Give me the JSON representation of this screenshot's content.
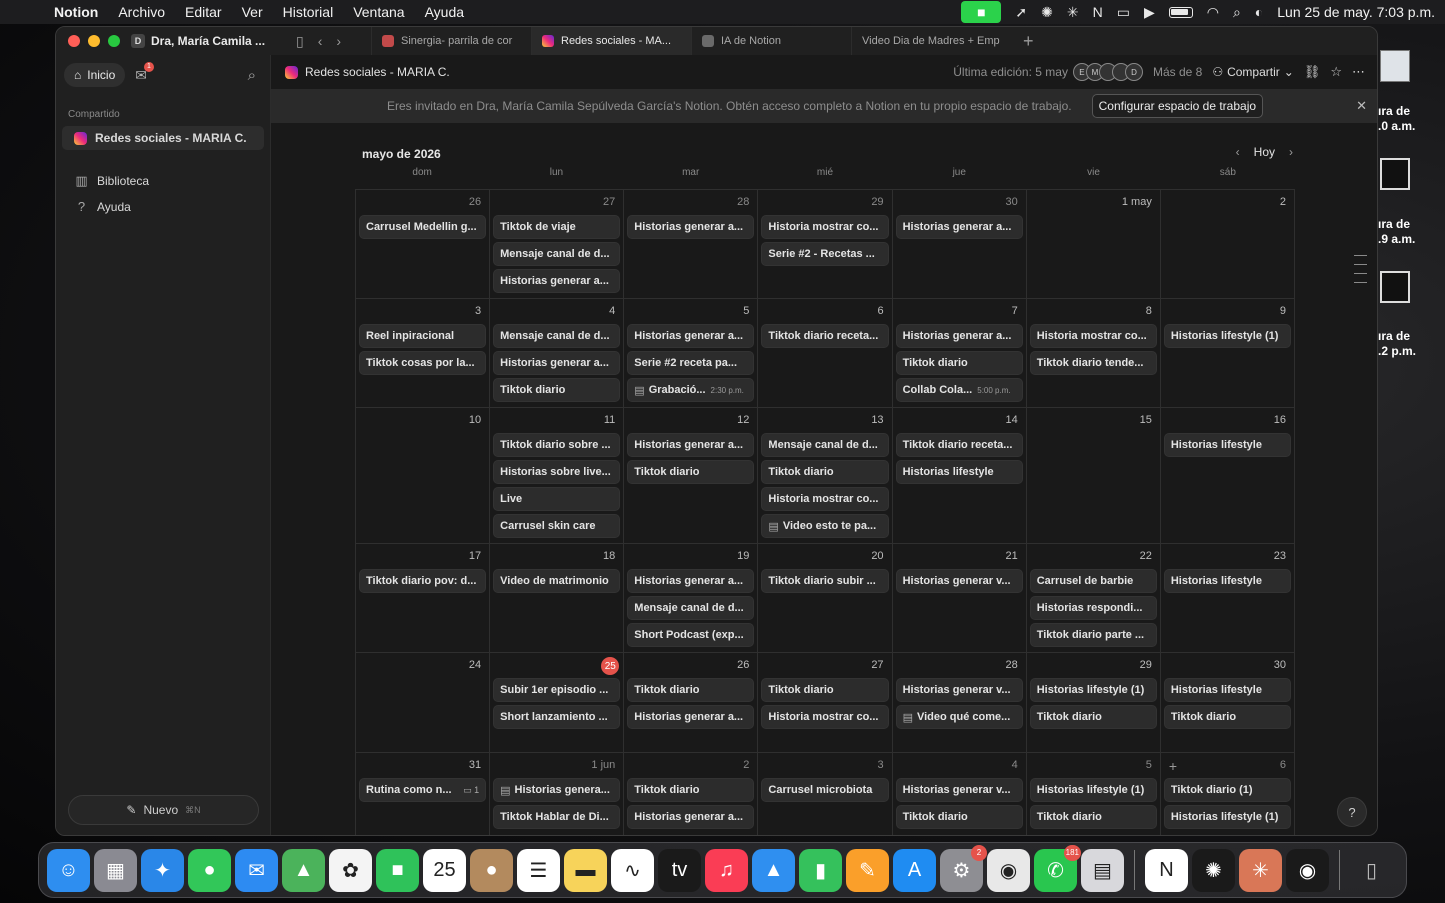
{
  "menubar": {
    "app": "Notion",
    "items": [
      "Archivo",
      "Editar",
      "Ver",
      "Historial",
      "Ventana",
      "Ayuda"
    ],
    "clock": "Lun 25 de may.  7:03 p.m."
  },
  "desktop": {
    "labels": [
      "ıra de\n.0 a.m.",
      "ıra de\n.9 a.m.",
      "ıra de\n.2 p.m."
    ]
  },
  "window": {
    "workspace": "Dra, María Camila ...",
    "workspace_initial": "D",
    "tabs": [
      {
        "label": "Sinergia- parrila de cor",
        "active": false
      },
      {
        "label": "Redes sociales - MA...",
        "active": true
      },
      {
        "label": "IA de Notion",
        "active": false
      },
      {
        "label": "Video Dia de Madres + Emp",
        "active": false
      }
    ]
  },
  "sidebar": {
    "home": "Inicio",
    "inbox_badge": "1",
    "section": "Compartido",
    "shared_page": "Redes sociales - MARIA C.",
    "library": "Biblioteca",
    "help": "Ayuda",
    "new_label": "Nuevo",
    "new_shortcut": "⌘N"
  },
  "header": {
    "title": "Redes sociales - MARIA C.",
    "last_edit": "Última edición: 5 may",
    "avatars": [
      "E",
      "M",
      "",
      "",
      "D"
    ],
    "more": "Más de 8",
    "share": "Compartir"
  },
  "banner": {
    "text": "Eres invitado en Dra, María Camila Sepúlveda García's Notion. Obtén acceso completo a Notion en tu propio espacio de trabajo.",
    "cta": "Configurar espacio de trabajo"
  },
  "calendar": {
    "month": "mayo de 2026",
    "today_label": "Hoy",
    "weekdays": [
      "dom",
      "lun",
      "mar",
      "mié",
      "jue",
      "vie",
      "sáb"
    ],
    "weeks": [
      {
        "days": [
          {
            "n": "26",
            "faded": true,
            "cards": [
              {
                "t": "Carrusel Medellin g..."
              }
            ]
          },
          {
            "n": "27",
            "faded": true,
            "cards": [
              {
                "t": "Tiktok de viaje"
              },
              {
                "t": "Mensaje canal de d..."
              },
              {
                "t": "Historias generar a..."
              }
            ]
          },
          {
            "n": "28",
            "faded": true,
            "cards": [
              {
                "t": "Historias generar a..."
              }
            ]
          },
          {
            "n": "29",
            "faded": true,
            "cards": [
              {
                "t": "Historia mostrar co..."
              },
              {
                "t": "Serie #2 - Recetas ..."
              }
            ]
          },
          {
            "n": "30",
            "faded": true,
            "cards": [
              {
                "t": "Historias generar a..."
              }
            ]
          },
          {
            "n": "1 may",
            "faded": false,
            "cards": []
          },
          {
            "n": "2",
            "faded": false,
            "cards": []
          }
        ]
      },
      {
        "days": [
          {
            "n": "3",
            "cards": [
              {
                "t": "Reel inpiracional"
              },
              {
                "t": "Tiktok cosas por la..."
              }
            ]
          },
          {
            "n": "4",
            "cards": [
              {
                "t": "Mensaje canal de d..."
              },
              {
                "t": "Historias generar a..."
              },
              {
                "t": "Tiktok diario"
              }
            ]
          },
          {
            "n": "5",
            "cards": [
              {
                "t": "Historias generar a..."
              },
              {
                "t": "Serie #2 receta pa..."
              },
              {
                "t": "Grabació...",
                "doc": true,
                "time": "2:30 p.m."
              }
            ]
          },
          {
            "n": "6",
            "cards": [
              {
                "t": "Tiktok diario receta..."
              }
            ]
          },
          {
            "n": "7",
            "cards": [
              {
                "t": "Historias generar a..."
              },
              {
                "t": "Tiktok diario"
              },
              {
                "t": "Collab Cola...",
                "time": "5:00 p.m."
              }
            ]
          },
          {
            "n": "8",
            "cards": [
              {
                "t": "Historia mostrar co..."
              },
              {
                "t": "Tiktok diario tende..."
              }
            ]
          },
          {
            "n": "9",
            "cards": [
              {
                "t": "Historias lifestyle (1)"
              }
            ]
          }
        ]
      },
      {
        "days": [
          {
            "n": "10",
            "cards": []
          },
          {
            "n": "11",
            "cards": [
              {
                "t": "Tiktok diario sobre ..."
              },
              {
                "t": "Historias sobre live..."
              },
              {
                "t": "Live"
              },
              {
                "t": "Carrusel skin care"
              }
            ]
          },
          {
            "n": "12",
            "cards": [
              {
                "t": "Historias generar a..."
              },
              {
                "t": "Tiktok diario"
              }
            ]
          },
          {
            "n": "13",
            "cards": [
              {
                "t": "Mensaje canal de d..."
              },
              {
                "t": "Tiktok diario"
              },
              {
                "t": "Historia mostrar co..."
              },
              {
                "t": "Video esto te pa...",
                "doc": true
              }
            ]
          },
          {
            "n": "14",
            "cards": [
              {
                "t": "Tiktok diario receta..."
              },
              {
                "t": "Historias lifestyle"
              }
            ]
          },
          {
            "n": "15",
            "cards": []
          },
          {
            "n": "16",
            "cards": [
              {
                "t": "Historias lifestyle"
              }
            ]
          }
        ]
      },
      {
        "days": [
          {
            "n": "17",
            "cards": [
              {
                "t": "Tiktok diario pov: d..."
              }
            ]
          },
          {
            "n": "18",
            "cards": [
              {
                "t": "Video de matrimonio"
              }
            ]
          },
          {
            "n": "19",
            "cards": [
              {
                "t": "Historias generar a..."
              },
              {
                "t": "Mensaje canal de d..."
              },
              {
                "t": "Short Podcast (exp..."
              }
            ]
          },
          {
            "n": "20",
            "cards": [
              {
                "t": "Tiktok diario subir ..."
              }
            ]
          },
          {
            "n": "21",
            "cards": [
              {
                "t": "Historias generar v..."
              }
            ]
          },
          {
            "n": "22",
            "cards": [
              {
                "t": "Carrusel de barbie"
              },
              {
                "t": "Historias respondi..."
              },
              {
                "t": "Tiktok diario parte ..."
              }
            ]
          },
          {
            "n": "23",
            "cards": [
              {
                "t": "Historias lifestyle"
              }
            ]
          }
        ]
      },
      {
        "days": [
          {
            "n": "24",
            "cards": []
          },
          {
            "n": "25",
            "today": true,
            "cards": [
              {
                "t": "Subir 1er episodio ..."
              },
              {
                "t": "Short lanzamiento ..."
              }
            ]
          },
          {
            "n": "26",
            "cards": [
              {
                "t": "Tiktok diario"
              },
              {
                "t": "Historias generar a..."
              }
            ]
          },
          {
            "n": "27",
            "cards": [
              {
                "t": "Tiktok diario"
              },
              {
                "t": "Historia mostrar co..."
              }
            ]
          },
          {
            "n": "28",
            "cards": [
              {
                "t": "Historias generar v..."
              },
              {
                "t": "Video qué come...",
                "doc": true
              }
            ]
          },
          {
            "n": "29",
            "cards": [
              {
                "t": "Historias lifestyle (1)"
              },
              {
                "t": "Tiktok diario"
              }
            ]
          },
          {
            "n": "30",
            "cards": [
              {
                "t": "Historias lifestyle"
              },
              {
                "t": "Tiktok diario"
              }
            ]
          }
        ]
      },
      {
        "days": [
          {
            "n": "31",
            "cards": [
              {
                "t": "Rutina como n...",
                "comments": "1"
              }
            ]
          },
          {
            "n": "1 jun",
            "faded": true,
            "cards": [
              {
                "t": "Historias genera...",
                "doc": true
              },
              {
                "t": "Tiktok Hablar de Di..."
              }
            ]
          },
          {
            "n": "2",
            "faded": true,
            "cards": [
              {
                "t": "Tiktok diario"
              },
              {
                "t": "Historias generar a..."
              }
            ]
          },
          {
            "n": "3",
            "faded": true,
            "cards": [
              {
                "t": "Carrusel microbiota"
              }
            ]
          },
          {
            "n": "4",
            "faded": true,
            "cards": [
              {
                "t": "Historias generar v..."
              },
              {
                "t": "Tiktok diario"
              }
            ]
          },
          {
            "n": "5",
            "faded": true,
            "cards": [
              {
                "t": "Historias lifestyle (1)"
              },
              {
                "t": "Tiktok diario"
              }
            ]
          },
          {
            "n": "6",
            "faded": true,
            "plus": true,
            "cards": [
              {
                "t": "Tiktok diario (1)"
              },
              {
                "t": "Historias lifestyle (1)"
              }
            ]
          }
        ]
      }
    ]
  },
  "dock": {
    "apps": [
      {
        "name": "finder-icon",
        "glyph": "☺",
        "bg": "#2e8ef0"
      },
      {
        "name": "launchpad-icon",
        "glyph": "▦",
        "bg": "#8a8a92"
      },
      {
        "name": "safari-icon",
        "glyph": "✦",
        "bg": "#2a87e8"
      },
      {
        "name": "messages-icon",
        "glyph": "●",
        "bg": "#32c759"
      },
      {
        "name": "mail-icon",
        "glyph": "✉",
        "bg": "#2d8bf2"
      },
      {
        "name": "maps-icon",
        "glyph": "▲",
        "bg": "#4bb35b"
      },
      {
        "name": "photos-icon",
        "glyph": "✿",
        "bg": "#f4f4f4"
      },
      {
        "name": "facetime-icon",
        "glyph": "■",
        "bg": "#2fc25a"
      },
      {
        "name": "calendar-icon",
        "glyph": "25",
        "bg": "#ffffff"
      },
      {
        "name": "contacts-icon",
        "glyph": "●",
        "bg": "#b38a5e"
      },
      {
        "name": "reminders-icon",
        "glyph": "☰",
        "bg": "#ffffff"
      },
      {
        "name": "notes-icon",
        "glyph": "▬",
        "bg": "#f7d35a"
      },
      {
        "name": "freeform-icon",
        "glyph": "∿",
        "bg": "#ffffff"
      },
      {
        "name": "tv-icon",
        "glyph": "tv",
        "bg": "#1a1a1a"
      },
      {
        "name": "music-icon",
        "glyph": "♫",
        "bg": "#fa3d55"
      },
      {
        "name": "keynote-icon",
        "glyph": "▲",
        "bg": "#2f8ff0"
      },
      {
        "name": "numbers-icon",
        "glyph": "▮",
        "bg": "#35c15c"
      },
      {
        "name": "pages-icon",
        "glyph": "✎",
        "bg": "#fa9f2a"
      },
      {
        "name": "app-store-icon",
        "glyph": "A",
        "bg": "#1f8cf2"
      },
      {
        "name": "settings-icon",
        "glyph": "⚙",
        "bg": "#8e8e93",
        "badge": "2"
      },
      {
        "name": "chrome-icon",
        "glyph": "◉",
        "bg": "#e8e8e8"
      },
      {
        "name": "whatsapp-icon",
        "glyph": "✆",
        "bg": "#29c64f",
        "badge": "181"
      },
      {
        "name": "preview-icon",
        "glyph": "▤",
        "bg": "#d8d8dc"
      },
      {
        "sep": true
      },
      {
        "name": "notion-icon",
        "glyph": "N",
        "bg": "#ffffff"
      },
      {
        "name": "chatgpt-icon",
        "glyph": "✺",
        "bg": "#1a1a1a"
      },
      {
        "name": "claude-icon",
        "glyph": "✳",
        "bg": "#d97757"
      },
      {
        "name": "spotify-icon",
        "glyph": "◉",
        "bg": "#1a1a1a"
      },
      {
        "sep": true
      },
      {
        "name": "trash-icon",
        "glyph": "▯",
        "bg": "transparent"
      }
    ]
  }
}
